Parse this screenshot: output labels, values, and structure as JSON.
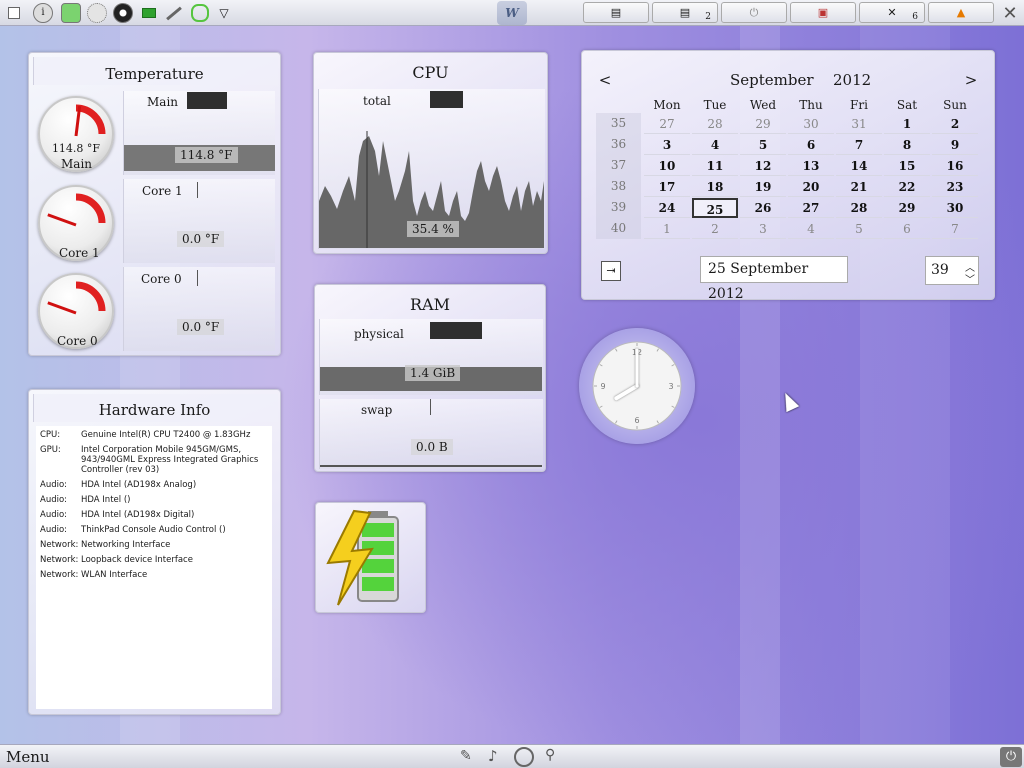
{
  "top_panel": {
    "icons": [
      "info-icon",
      "rss-icon",
      "network-icon",
      "disc-icon",
      "battery-status-icon",
      "pen-icon",
      "lasso-icon",
      "chevron-down-icon"
    ],
    "center_logo": "W",
    "tasks": [
      {
        "icon": "window-list-icon",
        "count": ""
      },
      {
        "icon": "window-list-icon",
        "count": "2"
      },
      {
        "icon": "power-icon",
        "count": ""
      },
      {
        "icon": "usb-icon",
        "count": ""
      },
      {
        "icon": "tools-icon",
        "count": "6"
      },
      {
        "icon": "vlc-cone-icon",
        "count": ""
      }
    ],
    "close_icon": "close-icon"
  },
  "temperature": {
    "title": "Temperature",
    "sensors": [
      {
        "name": "Main",
        "value": "114.8 °F",
        "level": 0.55
      },
      {
        "name": "Core 1",
        "value": "0.0 °F",
        "level": 0
      },
      {
        "name": "Core 0",
        "value": "0.0 °F",
        "level": 0
      }
    ]
  },
  "cpu": {
    "title": "CPU",
    "label": "total",
    "value": "35.4 %"
  },
  "ram": {
    "title": "RAM",
    "physical_label": "physical",
    "physical_value": "1.4 GiB",
    "swap_label": "swap",
    "swap_value": "0.0 B"
  },
  "hardware": {
    "title": "Hardware Info",
    "rows": [
      {
        "k": "CPU:",
        "v": "Genuine Intel(R) CPU T2400 @ 1.83GHz"
      },
      {
        "k": "GPU:",
        "v": "Intel Corporation Mobile 945GM/GMS, 943/940GML Express Integrated Graphics Controller (rev 03)"
      },
      {
        "k": "Audio:",
        "v": "HDA Intel (AD198x Analog)"
      },
      {
        "k": "Audio:",
        "v": "HDA Intel ()"
      },
      {
        "k": "Audio:",
        "v": "HDA Intel (AD198x Digital)"
      },
      {
        "k": "Audio:",
        "v": "ThinkPad Console Audio Control ()"
      },
      {
        "k": "Network:",
        "v": "Networking Interface"
      },
      {
        "k": "Network:",
        "v": "Loopback device Interface"
      },
      {
        "k": "Network:",
        "v": "WLAN Interface"
      }
    ]
  },
  "calendar": {
    "prev": "<",
    "next": ">",
    "month": "September",
    "year": "2012",
    "weekdays": [
      "Mon",
      "Tue",
      "Wed",
      "Thu",
      "Fri",
      "Sat",
      "Sun"
    ],
    "weeks": [
      {
        "wk": "35",
        "days": [
          "27",
          "28",
          "29",
          "30",
          "31",
          "1",
          "2"
        ]
      },
      {
        "wk": "36",
        "days": [
          "3",
          "4",
          "5",
          "6",
          "7",
          "8",
          "9"
        ]
      },
      {
        "wk": "37",
        "days": [
          "10",
          "11",
          "12",
          "13",
          "14",
          "15",
          "16"
        ]
      },
      {
        "wk": "38",
        "days": [
          "17",
          "18",
          "19",
          "20",
          "21",
          "22",
          "23"
        ]
      },
      {
        "wk": "39",
        "days": [
          "24",
          "25",
          "26",
          "27",
          "28",
          "29",
          "30"
        ]
      },
      {
        "wk": "40",
        "days": [
          "1",
          "2",
          "3",
          "4",
          "5",
          "6",
          "7"
        ]
      }
    ],
    "date_value": "25 September 2012",
    "week_value": "39"
  },
  "clock": {
    "hour": 3,
    "minute": 0,
    "numbers": [
      "12",
      "3",
      "6",
      "9"
    ]
  },
  "battery": {
    "charge": 1.0,
    "icon": "battery-charging-icon"
  },
  "bottom_panel": {
    "menu": "Menu",
    "icons": [
      "pen-icon",
      "music-note-icon",
      "globe-icon",
      "search-icon"
    ],
    "power": "power-icon"
  }
}
